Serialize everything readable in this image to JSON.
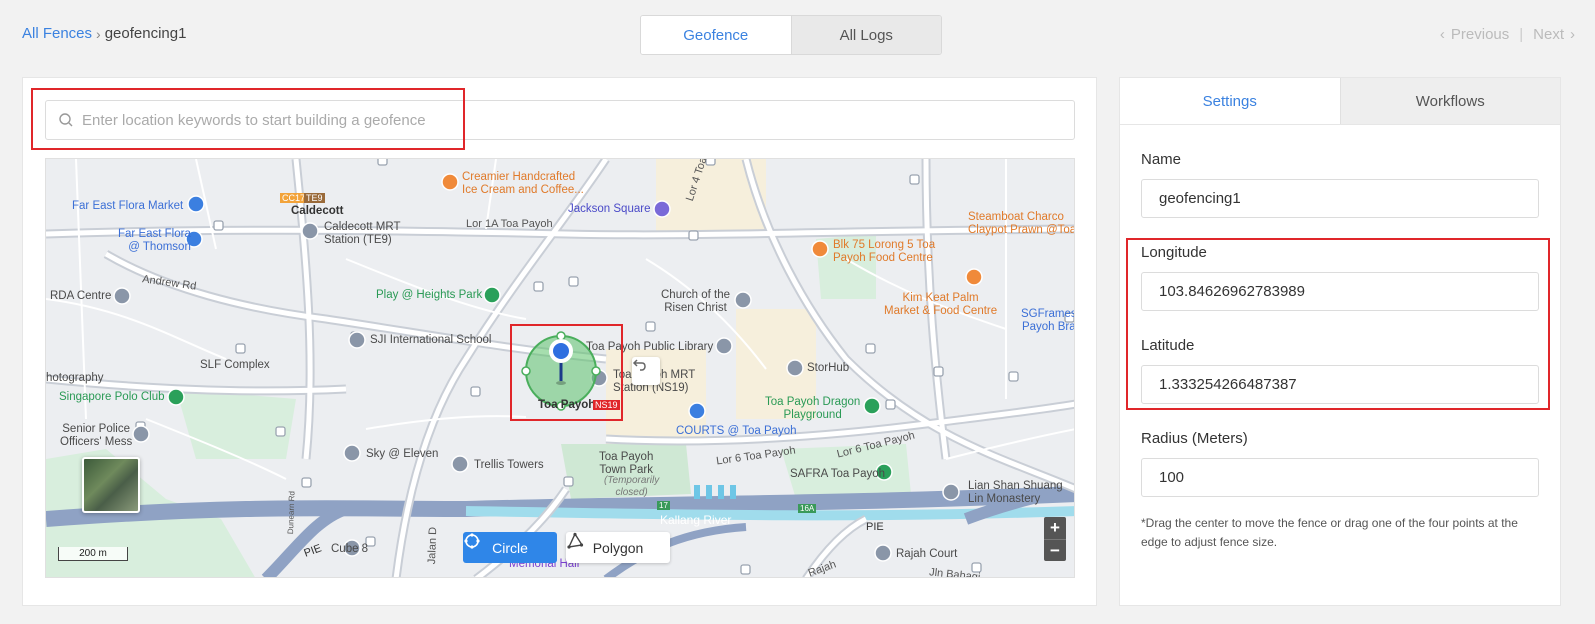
{
  "breadcrumb": {
    "parent": "All Fences",
    "current": "geofencing1"
  },
  "view_tabs": {
    "geofence": "Geofence",
    "all_logs": "All Logs"
  },
  "pager": {
    "previous": "Previous",
    "next": "Next"
  },
  "search": {
    "placeholder": "Enter location keywords to start building a geofence",
    "value": ""
  },
  "map": {
    "labels": {
      "creamier": "Creamier Handcrafted\nIce Cream and Coffee...",
      "far_east_market": "Far East Flora Market",
      "caldecott": "Caldecott",
      "caldecott_mrt": "Caldecott MRT\nStation (TE9)",
      "far_east_thomson": "Far East Flora\n@ Thomson",
      "lor1a": "Lor 1A Toa Payoh",
      "jackson": "Jackson Square",
      "lor4": "Lor 4 Toa Payoh",
      "steamboat": "Steamboat Charco\nClaypot Prawn @Toa",
      "blk75": "Blk 75 Lorong 5 Toa\nPayoh Food Centre",
      "andrew": "Andrew Rd",
      "rda": "RDA Centre",
      "play_heights": "Play @ Heights Park",
      "church": "Church of the\nRisen Christ",
      "kim_keat": "Kim Keat Palm\nMarket & Food Centre",
      "sgframes": "SGFrames\nPayoh Bra",
      "sji": "SJI International School",
      "tp_library": "Toa Payoh Public Library",
      "slf": "SLF Complex",
      "photography": "hotography",
      "tp_mrt": "Toa Payoh MRT\nStation (NS19)",
      "storhub": "StorHub",
      "polo": "Singapore Polo Club",
      "toa_payoh": "Toa Payoh",
      "dragon": "Toa Payoh Dragon\nPlayground",
      "senior_police": "Senior Police\nOfficers' Mess",
      "courts": "COURTS @ Toa Payoh",
      "lor6": "Lor 6 Toa Payoh",
      "lor6b": "Lor 6 Toa Payoh",
      "sky_eleven": "Sky @ Eleven",
      "trellis": "Trellis Towers",
      "town_park": "Toa Payoh\nTown Park",
      "temporarily_closed": "(Temporarily\nclosed)",
      "safra": "SAFRA Toa Payoh",
      "lian_shan": "Lian Shan Shuang\nLin Monastery",
      "kallang": "Kallang River",
      "pie1": "PIE",
      "pie2": "PIE",
      "cube8": "Cube 8",
      "rajah_court": "Rajah Court",
      "memorial": "Memorial Hall",
      "rajah": "Rajah",
      "jln_bahagia": "Jln Bahagi",
      "jalan": "Jalan D",
      "dunearn": "Dunearn Rd",
      "cc17": "CC17",
      "te9": "TE9",
      "ns19": "NS19",
      "t17": "17",
      "t16a": "16A"
    },
    "scale_label": "200 m",
    "draw_circle": "Circle",
    "draw_polygon": "Polygon",
    "zoom_in": "+",
    "zoom_out": "−"
  },
  "settings": {
    "tabs": {
      "settings": "Settings",
      "workflows": "Workflows"
    },
    "name_label": "Name",
    "name_value": "geofencing1",
    "longitude_label": "Longitude",
    "longitude_value": "103.84626962783989",
    "latitude_label": "Latitude",
    "latitude_value": "1.333254266487387",
    "radius_label": "Radius (Meters)",
    "radius_value": "100",
    "hint": "*Drag the center to move the fence or drag one of the four points at the edge to adjust fence size."
  },
  "colors": {
    "accent": "#3b82e0",
    "highlight": "#e0262a",
    "fence": "#5cc36c"
  }
}
